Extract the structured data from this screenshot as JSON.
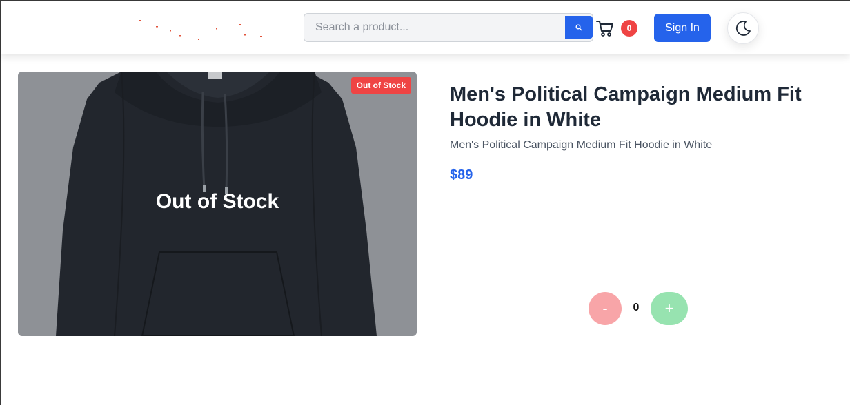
{
  "header": {
    "search": {
      "placeholder": "Search a product...",
      "value": ""
    },
    "cart": {
      "count": "0"
    },
    "signin_label": "Sign In"
  },
  "product": {
    "badge": "Out of Stock",
    "overlay_text": "Out of Stock",
    "title": "Men's Political Campaign Medium Fit Hoodie in White",
    "description": "Men's Political Campaign Medium Fit Hoodie in White",
    "price": "$89"
  },
  "quantity": {
    "minus_label": "-",
    "value": "0",
    "plus_label": "+"
  },
  "colors": {
    "accent": "#2563eb",
    "danger": "#ef4444",
    "minus_bg": "#f8a5a8",
    "plus_bg": "#97e3b0"
  }
}
